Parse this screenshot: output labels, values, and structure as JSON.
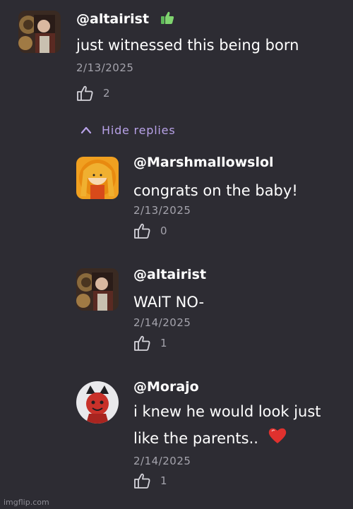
{
  "comments": [
    {
      "handle": "@altairist",
      "text": "just witnessed this being born",
      "date": "2/13/2025",
      "likes": "2"
    }
  ],
  "replies_toggle": {
    "label": "Hide replies"
  },
  "replies": [
    {
      "handle": "@Marshmallowslol",
      "text": "congrats on the baby!",
      "date": "2/13/2025",
      "likes": "0"
    },
    {
      "handle": "@altairist",
      "text": "WAIT NO-",
      "date": "2/14/2025",
      "likes": "1"
    },
    {
      "handle": "@Morajo",
      "text_line1": "i knew he would look just",
      "text_line2": "like the parents..",
      "date": "2/14/2025",
      "likes": "1"
    }
  ],
  "watermark": "imgflip.com",
  "icons": {
    "thumbs_up_emoji": "thumbs-up-emoji",
    "heart_emoji": "red-heart-emoji",
    "like": "thumbs-up-outline-icon",
    "chevron": "chevron-up-icon"
  },
  "colors": {
    "background": "#2d2c33",
    "accent": "#b8a2e8",
    "muted": "#a4a3ac"
  }
}
